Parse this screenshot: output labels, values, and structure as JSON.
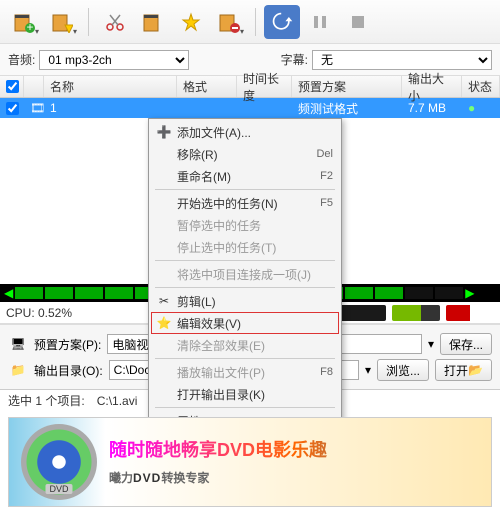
{
  "toolbar": {
    "icons": [
      "film-add",
      "film-star",
      "scissors",
      "film-strip",
      "star-gear",
      "film-remove",
      "sync",
      "pause",
      "stop"
    ]
  },
  "options": {
    "audio_label": "音频:",
    "audio_value": "01 mp3-2ch",
    "subtitle_label": "字幕:",
    "subtitle_value": "无"
  },
  "table": {
    "headers": {
      "name": "名称",
      "format": "格式",
      "duration": "时间长度",
      "preset": "预置方案",
      "size": "输出大小",
      "status": "状态"
    },
    "row": {
      "name": "1",
      "format": "",
      "duration": "",
      "preset": "频测试格式",
      "size": "7.7 MB",
      "status": "✓"
    }
  },
  "ctx": {
    "add": "添加文件(A)...",
    "remove": "移除(R)",
    "rename": "重命名(M)",
    "sc_remove": "Del",
    "sc_rename": "F2",
    "start": "开始选中的任务(N)",
    "pause": "暂停选中的任务",
    "stop": "停止选中的任务(T)",
    "sc_start": "F5",
    "merge": "将选中项目连接成一项(J)",
    "cut": "剪辑(L)",
    "fx": "编辑效果(V)",
    "clearfx": "清除全部效果(E)",
    "play": "播放输出文件(P)",
    "opendir": "打开输出目录(K)",
    "sc_play": "F8",
    "prop": "属性(S)"
  },
  "cpu": {
    "label": "CPU: 0.52%"
  },
  "settings": {
    "preset_label": "预置方案(P):",
    "preset_value": "电脑视频测试格式",
    "save": "保存...",
    "outdir_label": "输出目录(O):",
    "outdir_value": "C:\\Documents and Settings\\Administra",
    "browse": "浏览...",
    "open": "打开"
  },
  "status": {
    "sel": "选中 1 个项目:",
    "path": "C:\\1.avi"
  },
  "banner": {
    "line1": "随时随地畅享DVD电影乐趣",
    "line2a": "曦力",
    "line2b": "DVD",
    "line2c": "转换专家"
  }
}
